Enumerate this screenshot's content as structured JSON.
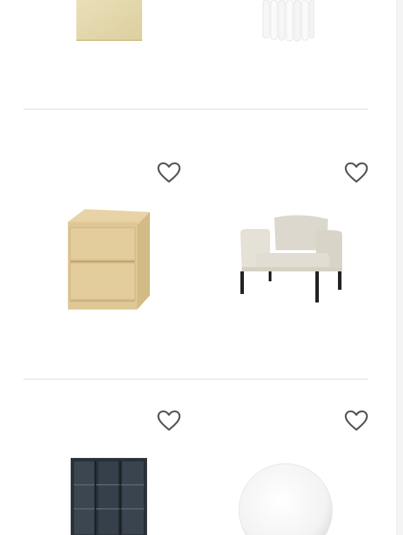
{
  "products": [
    {
      "name": "",
      "image": "beige-textile-product-image"
    },
    {
      "name": "",
      "image": "white-curtain-product-image"
    },
    {
      "name": "",
      "image": "birch-nightstand-product-image"
    },
    {
      "name": "",
      "image": "beige-armchair-product-image"
    },
    {
      "name": "",
      "image": "dark-glass-cabinet-product-image"
    },
    {
      "name": "",
      "image": "white-globe-lamp-product-image"
    }
  ],
  "icons": {
    "favorite": "heart-outline-icon"
  },
  "colors": {
    "background": "#ffffff",
    "divider": "#d9d9d9",
    "heart_stroke": "#555555"
  }
}
